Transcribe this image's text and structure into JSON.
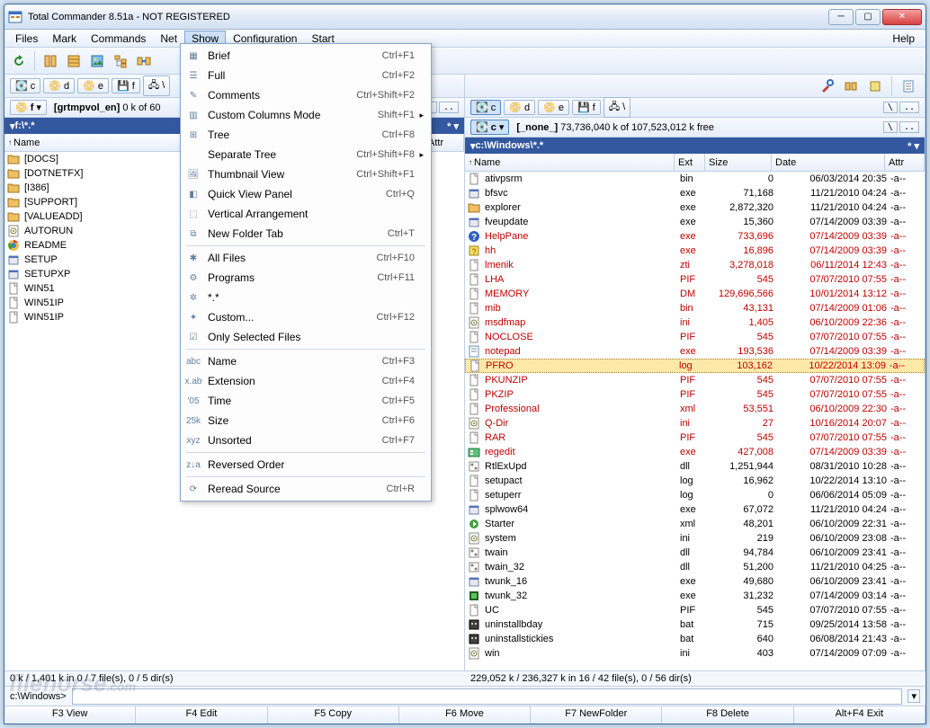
{
  "window": {
    "title": "Total Commander 8.51a - NOT REGISTERED"
  },
  "menu": {
    "items": [
      "Files",
      "Mark",
      "Commands",
      "Net",
      "Show",
      "Configuration",
      "Start"
    ],
    "help": "Help",
    "open_index": 4
  },
  "show_menu": [
    {
      "icon": "brief",
      "label": "Brief",
      "shortcut": "Ctrl+F1"
    },
    {
      "icon": "full",
      "label": "Full",
      "shortcut": "Ctrl+F2"
    },
    {
      "icon": "comments",
      "label": "Comments",
      "shortcut": "Ctrl+Shift+F2"
    },
    {
      "icon": "columns",
      "label": "Custom Columns Mode",
      "shortcut": "Shift+F1",
      "submenu": true
    },
    {
      "icon": "tree",
      "label": "Tree",
      "shortcut": "Ctrl+F8"
    },
    {
      "icon": "",
      "label": "Separate Tree",
      "shortcut": "Ctrl+Shift+F8",
      "submenu": true
    },
    {
      "icon": "thumb",
      "label": "Thumbnail View",
      "shortcut": "Ctrl+Shift+F1"
    },
    {
      "icon": "quickview",
      "label": "Quick View Panel",
      "shortcut": "Ctrl+Q"
    },
    {
      "icon": "vsplit",
      "label": "Vertical Arrangement",
      "shortcut": ""
    },
    {
      "icon": "newtab",
      "label": "New Folder Tab",
      "shortcut": "Ctrl+T"
    },
    {
      "sep": true
    },
    {
      "icon": "allfiles",
      "label": "All Files",
      "shortcut": "Ctrl+F10"
    },
    {
      "icon": "programs",
      "label": "Programs",
      "shortcut": "Ctrl+F11"
    },
    {
      "icon": "star",
      "label": "*.*",
      "shortcut": ""
    },
    {
      "icon": "custom",
      "label": "Custom...",
      "shortcut": "Ctrl+F12"
    },
    {
      "icon": "selected",
      "label": "Only Selected Files",
      "shortcut": ""
    },
    {
      "sep": true
    },
    {
      "icon": "sortname",
      "label": "Name",
      "shortcut": "Ctrl+F3"
    },
    {
      "icon": "sortext",
      "label": "Extension",
      "shortcut": "Ctrl+F4"
    },
    {
      "icon": "sorttime",
      "label": "Time",
      "shortcut": "Ctrl+F5"
    },
    {
      "icon": "sortsize",
      "label": "Size",
      "shortcut": "Ctrl+F6"
    },
    {
      "icon": "sortun",
      "label": "Unsorted",
      "shortcut": "Ctrl+F7"
    },
    {
      "sep": true
    },
    {
      "icon": "reverse",
      "label": "Reversed Order",
      "shortcut": ""
    },
    {
      "sep": true
    },
    {
      "icon": "reread",
      "label": "Reread Source",
      "shortcut": "Ctrl+R"
    }
  ],
  "left": {
    "drive_letter": "f",
    "drive_label": "[grtmpvol_en]",
    "space": "0 k of 60",
    "path": "f:\\*.*",
    "hdr_name": "Name",
    "hdr_attr": "Attr",
    "files": [
      {
        "icon": "folder",
        "name": "[DOCS]"
      },
      {
        "icon": "folder",
        "name": "[DOTNETFX]"
      },
      {
        "icon": "folder",
        "name": "[I386]"
      },
      {
        "icon": "folder",
        "name": "[SUPPORT]"
      },
      {
        "icon": "folder",
        "name": "[VALUEADD]"
      },
      {
        "icon": "ini",
        "name": "AUTORUN"
      },
      {
        "icon": "chrome",
        "name": "README"
      },
      {
        "icon": "exe",
        "name": "SETUP"
      },
      {
        "icon": "exe",
        "name": "SETUPXP"
      },
      {
        "icon": "file",
        "name": "WIN51"
      },
      {
        "icon": "file",
        "name": "WIN51IP"
      },
      {
        "icon": "file",
        "name": "WIN51IP"
      }
    ]
  },
  "right": {
    "drive_letter": "c",
    "drive_label": "[_none_]",
    "space": "73,736,040 k of  107,523,012 k free",
    "path": "c:\\Windows\\*.*",
    "hdr_name": "Name",
    "hdr_ext": "Ext",
    "hdr_size": "Size",
    "hdr_date": "Date",
    "hdr_attr": "Attr",
    "files": [
      {
        "icon": "file",
        "name": "ativpsrm",
        "ext": "bin",
        "size": "0",
        "date": "06/03/2014 20:35",
        "attr": "-a--"
      },
      {
        "icon": "exe",
        "name": "bfsvc",
        "ext": "exe",
        "size": "71,168",
        "date": "11/21/2010 04:24",
        "attr": "-a--"
      },
      {
        "icon": "folder",
        "name": "explorer",
        "ext": "exe",
        "size": "2,872,320",
        "date": "11/21/2010 04:24",
        "attr": "-a--"
      },
      {
        "icon": "exe",
        "name": "fveupdate",
        "ext": "exe",
        "size": "15,360",
        "date": "07/14/2009 03:39",
        "attr": "-a--"
      },
      {
        "icon": "help",
        "name": "HelpPane",
        "ext": "exe",
        "size": "733,696",
        "date": "07/14/2009 03:39",
        "attr": "-a--",
        "red": true
      },
      {
        "icon": "hh",
        "name": "hh",
        "ext": "exe",
        "size": "16,896",
        "date": "07/14/2009 03:39",
        "attr": "-a--",
        "red": true
      },
      {
        "icon": "file",
        "name": "lmenik",
        "ext": "zti",
        "size": "3,278,018",
        "date": "06/11/2014 12:43",
        "attr": "-a--",
        "red": true
      },
      {
        "icon": "file",
        "name": "LHA",
        "ext": "PIF",
        "size": "545",
        "date": "07/07/2010 07:55",
        "attr": "-a--",
        "red": true
      },
      {
        "icon": "file",
        "name": "MEMORY",
        "ext": "DM",
        "size": "129,696,566",
        "date": "10/01/2014 13:12",
        "attr": "-a--",
        "red": true
      },
      {
        "icon": "file",
        "name": "mib",
        "ext": "bin",
        "size": "43,131",
        "date": "07/14/2009 01:06",
        "attr": "-a--",
        "red": true
      },
      {
        "icon": "ini",
        "name": "msdfmap",
        "ext": "ini",
        "size": "1,405",
        "date": "06/10/2009 22:36",
        "attr": "-a--",
        "red": true
      },
      {
        "icon": "file",
        "name": "NOCLOSE",
        "ext": "PIF",
        "size": "545",
        "date": "07/07/2010 07:55",
        "attr": "-a--",
        "red": true
      },
      {
        "icon": "notepad",
        "name": "notepad",
        "ext": "exe",
        "size": "193,536",
        "date": "07/14/2009 03:39",
        "attr": "-a--",
        "red": true
      },
      {
        "icon": "file",
        "name": "PFRO",
        "ext": "log",
        "size": "103,162",
        "date": "10/22/2014 13:09",
        "attr": "-a--",
        "red": true,
        "selected": true
      },
      {
        "icon": "file",
        "name": "PKUNZIP",
        "ext": "PIF",
        "size": "545",
        "date": "07/07/2010 07:55",
        "attr": "-a--",
        "red": true
      },
      {
        "icon": "file",
        "name": "PKZIP",
        "ext": "PIF",
        "size": "545",
        "date": "07/07/2010 07:55",
        "attr": "-a--",
        "red": true
      },
      {
        "icon": "file",
        "name": "Professional",
        "ext": "xml",
        "size": "53,551",
        "date": "06/10/2009 22:30",
        "attr": "-a--",
        "red": true
      },
      {
        "icon": "ini",
        "name": "Q-Dir",
        "ext": "ini",
        "size": "27",
        "date": "10/16/2014 20:07",
        "attr": "-a--",
        "red": true
      },
      {
        "icon": "file",
        "name": "RAR",
        "ext": "PIF",
        "size": "545",
        "date": "07/07/2010 07:55",
        "attr": "-a--",
        "red": true
      },
      {
        "icon": "regedit",
        "name": "regedit",
        "ext": "exe",
        "size": "427,008",
        "date": "07/14/2009 03:39",
        "attr": "-a--",
        "red": true
      },
      {
        "icon": "dll",
        "name": "RtlExUpd",
        "ext": "dll",
        "size": "1,251,944",
        "date": "08/31/2010 10:28",
        "attr": "-a--"
      },
      {
        "icon": "file",
        "name": "setupact",
        "ext": "log",
        "size": "16,962",
        "date": "10/22/2014 13:10",
        "attr": "-a--"
      },
      {
        "icon": "file",
        "name": "setuperr",
        "ext": "log",
        "size": "0",
        "date": "06/06/2014 05:09",
        "attr": "-a--"
      },
      {
        "icon": "exe",
        "name": "splwow64",
        "ext": "exe",
        "size": "67,072",
        "date": "11/21/2010 04:24",
        "attr": "-a--"
      },
      {
        "icon": "starter",
        "name": "Starter",
        "ext": "xml",
        "size": "48,201",
        "date": "06/10/2009 22:31",
        "attr": "-a--"
      },
      {
        "icon": "ini",
        "name": "system",
        "ext": "ini",
        "size": "219",
        "date": "06/10/2009 23:08",
        "attr": "-a--"
      },
      {
        "icon": "dll",
        "name": "twain",
        "ext": "dll",
        "size": "94,784",
        "date": "06/10/2009 23:41",
        "attr": "-a--"
      },
      {
        "icon": "dll",
        "name": "twain_32",
        "ext": "dll",
        "size": "51,200",
        "date": "11/21/2010 04:25",
        "attr": "-a--"
      },
      {
        "icon": "exe",
        "name": "twunk_16",
        "ext": "exe",
        "size": "49,680",
        "date": "06/10/2009 23:41",
        "attr": "-a--"
      },
      {
        "icon": "twunk",
        "name": "twunk_32",
        "ext": "exe",
        "size": "31,232",
        "date": "07/14/2009 03:14",
        "attr": "-a--"
      },
      {
        "icon": "file",
        "name": "UC",
        "ext": "PIF",
        "size": "545",
        "date": "07/07/2010 07:55",
        "attr": "-a--"
      },
      {
        "icon": "bat",
        "name": "uninstallbday",
        "ext": "bat",
        "size": "715",
        "date": "09/25/2014 13:58",
        "attr": "-a--"
      },
      {
        "icon": "bat",
        "name": "uninstallstickies",
        "ext": "bat",
        "size": "640",
        "date": "06/08/2014 21:43",
        "attr": "-a--"
      },
      {
        "icon": "ini",
        "name": "win",
        "ext": "ini",
        "size": "403",
        "date": "07/14/2009 07:09",
        "attr": "-a--"
      }
    ]
  },
  "status": {
    "left": "0 k / 1,401 k in 0 / 7 file(s), 0 / 5 dir(s)",
    "right": "229,052 k / 236,327 k in 16 / 42 file(s), 0 / 56 dir(s)"
  },
  "cmdline": {
    "prompt": "c:\\Windows>"
  },
  "fkeys": [
    "F3 View",
    "F4 Edit",
    "F5 Copy",
    "F6 Move",
    "F7 NewFolder",
    "F8 Delete",
    "Alt+F4 Exit"
  ],
  "drives": [
    "c",
    "d",
    "e",
    "f"
  ]
}
